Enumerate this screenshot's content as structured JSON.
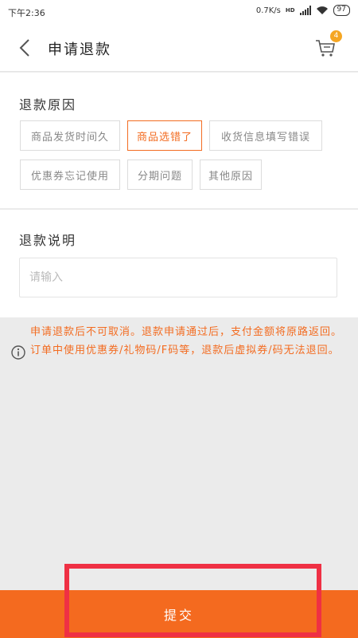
{
  "status_bar": {
    "time": "下午2:36",
    "network_speed": "0.7K/s",
    "network_type": "HD",
    "battery": "97"
  },
  "header": {
    "title": "申请退款",
    "cart_badge": "4",
    "icons": {
      "back": "chevron-left-icon",
      "cart": "cart-icon"
    }
  },
  "reason": {
    "title": "退款原因",
    "tags": [
      {
        "label": "商品发货时间久",
        "selected": false
      },
      {
        "label": "商品选错了",
        "selected": true
      },
      {
        "label": "收货信息填写错误",
        "selected": false
      },
      {
        "label": "优惠券忘记使用",
        "selected": false
      },
      {
        "label": "分期问题",
        "selected": false
      },
      {
        "label": "其他原因",
        "selected": false
      }
    ]
  },
  "description": {
    "title": "退款说明",
    "placeholder": "请输入",
    "value": ""
  },
  "notice": {
    "icon": "info-icon",
    "text": "申请退款后不可取消。退款申请通过后，支付金额将原路返回。订单中使用优惠券/礼物码/F码等，退款后虚拟券/码无法退回。"
  },
  "footer": {
    "submit_label": "提交"
  },
  "colors": {
    "accent": "#f46a1f",
    "badge": "#f5a623",
    "highlight": "#ef3044"
  }
}
